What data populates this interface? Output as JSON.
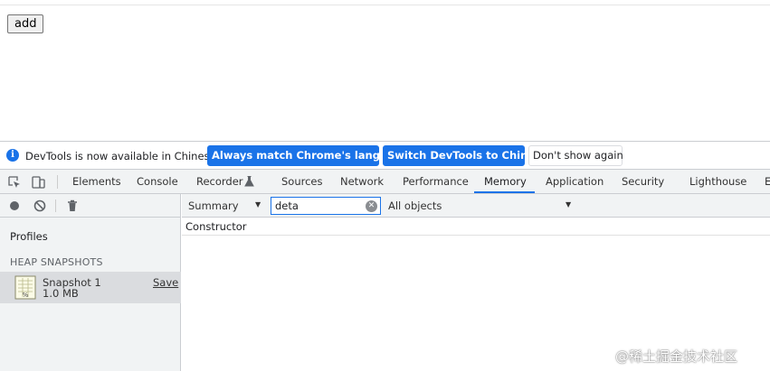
{
  "page": {
    "add_label": "add"
  },
  "infobar": {
    "message": "DevTools is now available in Chinese!",
    "btn_match": "Always match Chrome's language",
    "btn_switch": "Switch DevTools to Chinese",
    "btn_dismiss": "Don't show again",
    "info_icon": "i"
  },
  "tabs": [
    {
      "label": "Elements"
    },
    {
      "label": "Console"
    },
    {
      "label": "Recorder"
    },
    {
      "label": "Sources"
    },
    {
      "label": "Network"
    },
    {
      "label": "Performance"
    },
    {
      "label": "Memory"
    },
    {
      "label": "Application"
    },
    {
      "label": "Security"
    },
    {
      "label": "Lighthouse"
    },
    {
      "label": "E"
    }
  ],
  "active_tab": "Memory",
  "sidebar": {
    "profiles_label": "Profiles",
    "heap_section": "HEAP SNAPSHOTS",
    "snapshot": {
      "name": "Snapshot 1",
      "size": "1.0 MB",
      "save": "Save"
    }
  },
  "toolbar": {
    "view_mode": "Summary",
    "filter_value": "deta",
    "objects_scope": "All objects",
    "clear_symbol": "✕"
  },
  "table": {
    "column": "Constructor"
  },
  "watermark": "@稀土掘金技术社区",
  "colors": {
    "accent": "#1a73e8",
    "panel_bg": "#f1f3f4",
    "selected_row": "#dadcdf"
  }
}
